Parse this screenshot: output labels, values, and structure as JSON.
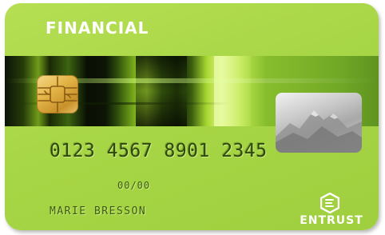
{
  "card": {
    "issuer_label": "FINANCIAL",
    "number": "0123 4567 8901 2345",
    "expiry": "00/00",
    "holder_name": "MARIE BRESSON",
    "brand_name": "ENTRUST",
    "colors": {
      "card_base": "#a7d646",
      "text_embossed": "#2f4a0c",
      "label_white": "#ffffff",
      "chip_gold": "#e3b548",
      "hologram_silver": "#c9c9c9"
    },
    "icons": [
      "chip-icon",
      "hologram-icon",
      "entrust-logo-icon"
    ]
  }
}
